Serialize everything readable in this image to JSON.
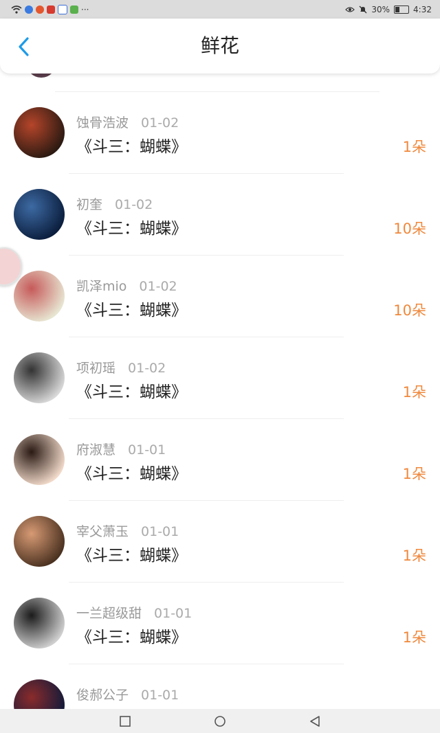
{
  "status_bar": {
    "icons": [
      "wifi-icon",
      "app-icon-blue",
      "app-icon-weibo",
      "app-icon-red",
      "app-icon-baidu",
      "app-icon-green",
      "more-dots-icon",
      "eye-icon",
      "mute-icon",
      "battery-icon"
    ],
    "more": "···",
    "battery": "30%",
    "time": "4:32"
  },
  "header": {
    "title": "鲜花"
  },
  "items": [
    {
      "user": "蚀骨浩波",
      "date": "01-02",
      "book": "《斗三：蝴蝶》",
      "amount": "1朵",
      "avatar_colors": [
        "#2b1a12",
        "#b5452a"
      ]
    },
    {
      "user": "初奎",
      "date": "01-02",
      "book": "《斗三：蝴蝶》",
      "amount": "10朵",
      "avatar_colors": [
        "#0b1e3d",
        "#3d6aa3"
      ]
    },
    {
      "user": "凯泽mio",
      "date": "01-02",
      "book": "《斗三：蝴蝶》",
      "amount": "10朵",
      "avatar_colors": [
        "#e7e6d2",
        "#c65a5a"
      ]
    },
    {
      "user": "项初瑶",
      "date": "01-02",
      "book": "《斗三：蝴蝶》",
      "amount": "1朵",
      "avatar_colors": [
        "#d8d8d8",
        "#333333"
      ]
    },
    {
      "user": "府淑慧",
      "date": "01-01",
      "book": "《斗三：蝴蝶》",
      "amount": "1朵",
      "avatar_colors": [
        "#f1d9c9",
        "#2a1a14"
      ]
    },
    {
      "user": "宰父萧玉",
      "date": "01-01",
      "book": "《斗三：蝴蝶》",
      "amount": "1朵",
      "avatar_colors": [
        "#4a3120",
        "#d79a74"
      ]
    },
    {
      "user": "一兰超级甜",
      "date": "01-01",
      "book": "《斗三：蝴蝶》",
      "amount": "1朵",
      "avatar_colors": [
        "#cfcfcf",
        "#1b1b1b"
      ]
    },
    {
      "user": "俊郝公子",
      "date": "01-01",
      "book": "",
      "amount": "",
      "avatar_colors": [
        "#101a3a",
        "#8a2b2b"
      ]
    }
  ],
  "colors": {
    "accent_orange": "#f0883c",
    "back_blue": "#1e9be8"
  }
}
